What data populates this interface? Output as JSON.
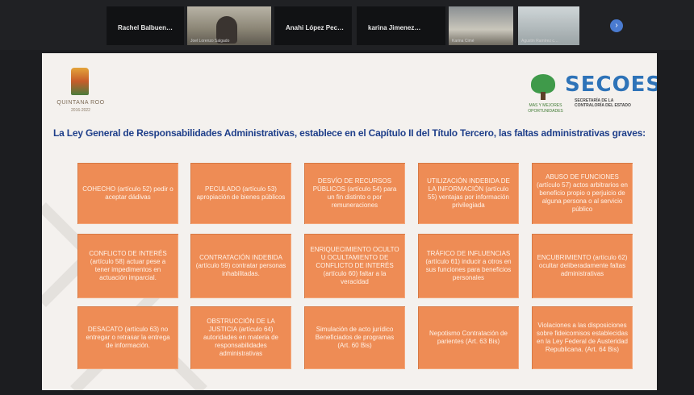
{
  "participants": [
    {
      "name": "Rachel  Balbuen…",
      "caption": ""
    },
    {
      "name": "",
      "caption": "Joel Lorenzo Salgado"
    },
    {
      "name": "Anahi López Pec…",
      "caption": ""
    },
    {
      "name": "karina  Jimenez…",
      "caption": "Karina Cimé"
    },
    {
      "name": "",
      "caption": "Agustin Ramírez c…"
    }
  ],
  "next_icon": "chevron-right-icon",
  "slide": {
    "left_logo": {
      "name": "QUINTANA ROO",
      "years": "2016-2022"
    },
    "right_logo": {
      "sub1": "MAS Y MEJORES",
      "sub2": "OPORTUNIDADES",
      "brand": "SECOES",
      "brand_sub1": "SECRETARÍA DE LA",
      "brand_sub2": "CONTRALORÍA DEL ESTADO"
    },
    "heading": "La Ley General de Responsabilidades Administrativas, establece en el Capítulo II del Título Tercero, las faltas administrativas graves:",
    "boxes": [
      "COHECHO (artículo 52) pedir o aceptar dádivas",
      "PECULADO (artículo 53) apropiación de bienes públicos",
      "DESVÍO DE RECURSOS PÚBLICOS (artículo 54) para un fin distinto o por remuneraciones",
      "UTILIZACIÓN INDEBIDA DE LA INFORMACIÓN (artículo 55) ventajas por información privilegiada",
      "ABUSO DE FUNCIONES (artículo 57) actos arbitrarios en beneficio propio o perjuicio de alguna persona o al servicio público",
      "CONFLICTO DE INTERÉS (artículo 58) actuar pese a tener impedimentos en actuación imparcial.",
      "CONTRATACIÓN INDEBIDA (artículo 59) contratar personas inhabilitadas.",
      "ENRIQUECIMIENTO OCULTO U OCULTAMIENTO DE CONFLICTO DE INTERÉS (artículo 60) faltar a la veracidad",
      "TRÁFICO DE INFLUENCIAS (artículo 61) inducir a otros en sus funciones para beneficios personales",
      "ENCUBRIMIENTO (artículo 62) ocultar deliberadamente faltas administrativas",
      "DESACATO (artículo 63) no entregar o retrasar la entrega de información.",
      "OBSTRUCCIÓN DE LA JUSTICIA (artículo 64) autoridades en materia de responsabilidades administrativas",
      "Simulación de acto jurídico Beneficiados de programas (Art. 60 Bis)",
      "Nepotismo Contratación de parientes (Art. 63 Bis)",
      "Violaciones a las disposiciones sobre fideicomisos establecidas en la Ley Federal de Austeridad Republicana. (Art. 64 Bis)"
    ]
  }
}
